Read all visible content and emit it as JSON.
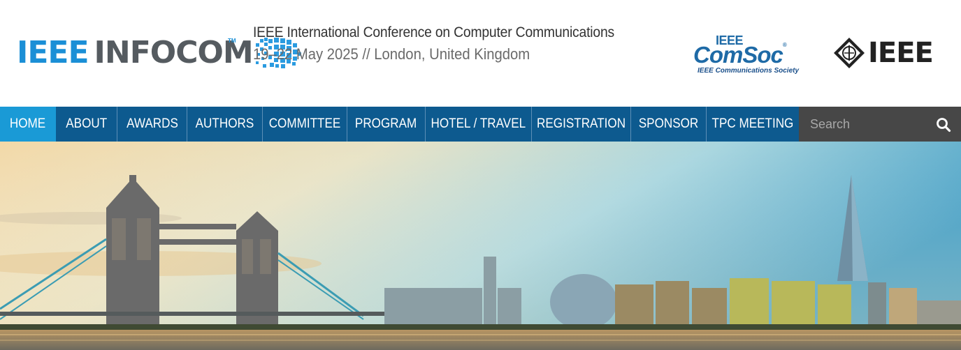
{
  "header": {
    "logo": {
      "part1": "IEEE",
      "part2": "INFOCOM",
      "tm": "TM"
    },
    "conference_title": "IEEE International Conference on Computer Communications",
    "conference_dates": "19–22 May 2025 // London, United Kingdom",
    "comsoc_logo": {
      "ieee": "IEEE",
      "name": "ComSoc",
      "reg": "®",
      "subtitle": "IEEE Communications Society"
    },
    "ieee_logo": {
      "word": "IEEE"
    }
  },
  "nav": {
    "items": [
      {
        "label": "HOME",
        "active": true
      },
      {
        "label": "ABOUT"
      },
      {
        "label": "AWARDS"
      },
      {
        "label": "AUTHORS"
      },
      {
        "label": "COMMITTEE"
      },
      {
        "label": "PROGRAM"
      },
      {
        "label": "HOTEL / TRAVEL"
      },
      {
        "label": "REGISTRATION"
      },
      {
        "label": "SPONSOR"
      },
      {
        "label": "TPC MEETING"
      }
    ],
    "search": {
      "placeholder": "Search",
      "icon": "search-icon"
    }
  },
  "hero": {
    "image": "london-skyline-tower-bridge"
  },
  "colors": {
    "nav_background": "#0d5a8f",
    "nav_active": "#1a9ad6",
    "search_background": "#474747",
    "brand_blue": "#1b8fd6",
    "comsoc_blue": "#1e6aa6"
  }
}
